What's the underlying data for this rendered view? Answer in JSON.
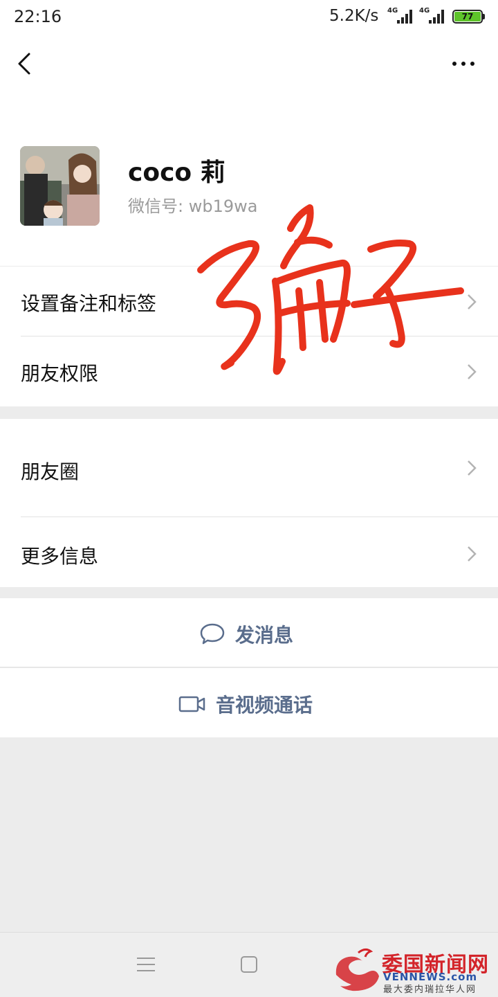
{
  "status_bar": {
    "time": "22:16",
    "net_speed": "5.2K/s",
    "sim1_type": "4G",
    "sim2_type": "4G",
    "battery": "77"
  },
  "nav": {
    "back_icon": "chevron-left-icon",
    "more_icon": "more-dots-icon"
  },
  "profile": {
    "name": "coco 莉",
    "wechat_id_label": "微信号:",
    "wechat_id": "wb19wa"
  },
  "annotation": {
    "handwritten": "骗子",
    "color": "#e8321c"
  },
  "menu_group_1": [
    {
      "label": "设置备注和标签"
    },
    {
      "label": "朋友权限"
    }
  ],
  "menu_group_2": [
    {
      "label": "朋友圈"
    },
    {
      "label": "更多信息"
    }
  ],
  "actions": {
    "send_message": "发消息",
    "video_call": "音视频通话",
    "accent_color": "#5a6d8c"
  },
  "watermark": {
    "title": "委国新闻网",
    "site": "VENNEWS.com",
    "slogan": "最大委内瑞拉华人网"
  }
}
